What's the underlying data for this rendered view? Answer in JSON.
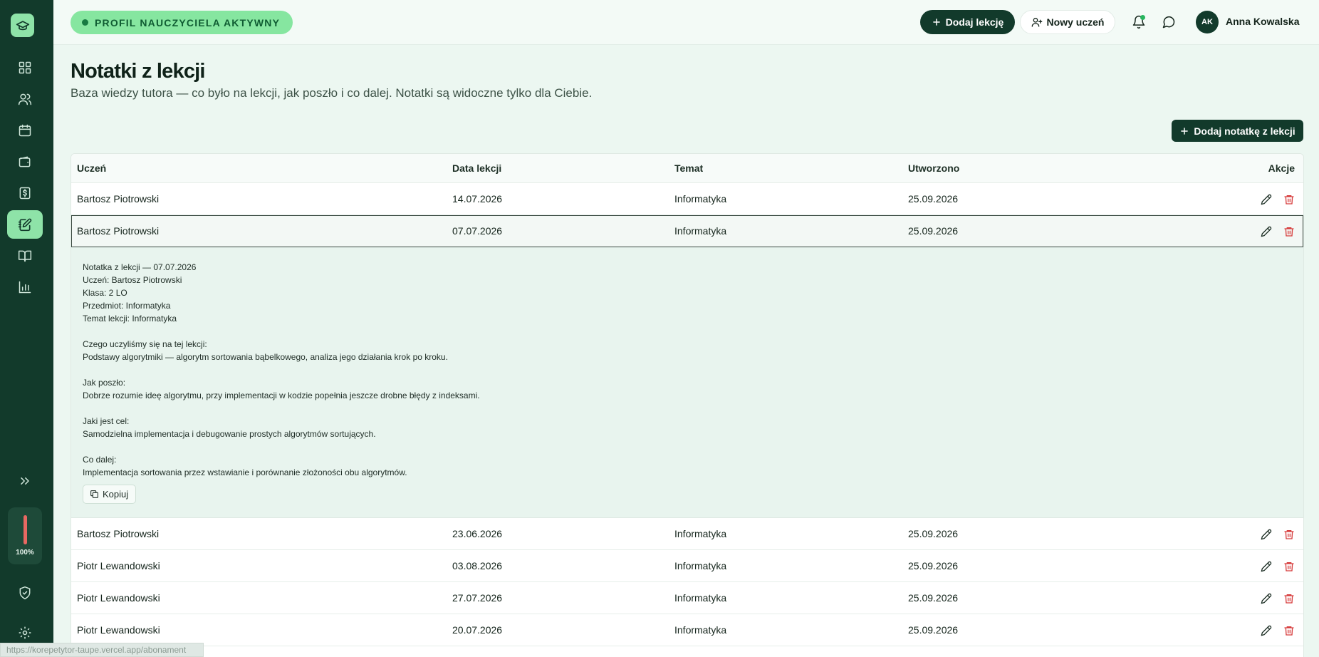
{
  "sidebar": {
    "logo_icon": "graduation-cap-icon",
    "items": [
      {
        "name": "dashboard",
        "icon": "grid-icon",
        "active": false
      },
      {
        "name": "students",
        "icon": "users-icon",
        "active": false
      },
      {
        "name": "calendar",
        "icon": "calendar-icon",
        "active": false
      },
      {
        "name": "wallet",
        "icon": "wallet-icon",
        "active": false
      },
      {
        "name": "payments",
        "icon": "dollar-icon",
        "active": false
      },
      {
        "name": "lesson-notes",
        "icon": "notebook-pen-icon",
        "active": true
      },
      {
        "name": "materials",
        "icon": "book-open-icon",
        "active": false
      },
      {
        "name": "reports",
        "icon": "bar-chart-icon",
        "active": false
      }
    ],
    "usage_label": "100%",
    "usage_level": 1.0
  },
  "topbar": {
    "status_badge": "PROFIL NAUCZYCIELA AKTYWNY",
    "add_lesson_label": "Dodaj lekcję",
    "new_student_label": "Nowy uczeń",
    "user_initials": "AK",
    "user_name": "Anna Kowalska"
  },
  "page": {
    "title": "Notatki z lekcji",
    "subtitle": "Baza wiedzy tutora — co było na lekcji, jak poszło i co dalej. Notatki są widoczne tylko dla Ciebie.",
    "add_note_label": "Dodaj notatkę z lekcji"
  },
  "table": {
    "columns": [
      "Uczeń",
      "Data lekcji",
      "Temat",
      "Utworzono",
      "Akcje"
    ],
    "rows": [
      {
        "student": "Bartosz Piotrowski",
        "date": "14.07.2026",
        "topic": "Informatyka",
        "created": "25.09.2026"
      },
      {
        "student": "Bartosz Piotrowski",
        "date": "07.07.2026",
        "topic": "Informatyka",
        "created": "25.09.2026"
      },
      {
        "student": "Bartosz Piotrowski",
        "date": "23.06.2026",
        "topic": "Informatyka",
        "created": "25.09.2026"
      },
      {
        "student": "Piotr Lewandowski",
        "date": "03.08.2026",
        "topic": "Informatyka",
        "created": "25.09.2026"
      },
      {
        "student": "Piotr Lewandowski",
        "date": "27.07.2026",
        "topic": "Informatyka",
        "created": "25.09.2026"
      },
      {
        "student": "Piotr Lewandowski",
        "date": "20.07.2026",
        "topic": "Informatyka",
        "created": "25.09.2026"
      }
    ],
    "detail": {
      "lines": [
        "Notatka z lekcji — 07.07.2026",
        "Uczeń: Bartosz Piotrowski",
        "Klasa: 2 LO",
        "Przedmiot: Informatyka",
        "Temat lekcji: Informatyka",
        "",
        "Czego uczyliśmy się na tej lekcji:",
        "Podstawy algorytmiki — algorytm sortowania bąbelkowego, analiza jego działania krok po kroku.",
        "",
        "Jak poszło:",
        "Dobrze rozumie ideę algorytmu, przy implementacji w kodzie popełnia jeszcze drobne błędy z indeksami.",
        "",
        "Jaki jest cel:",
        "Samodzielna implementacja i debugowanie prostych algorytmów sortujących.",
        "",
        "Co dalej:",
        "Implementacja sortowania przez wstawianie i porównanie złożoności obu algorytmów."
      ],
      "copy_label": "Kopiuj"
    }
  },
  "status_bar": {
    "url": "https://korepetytor-taupe.vercel.app/abonament"
  },
  "colors": {
    "sidebar_bg": "#123a2b",
    "accent_green": "#86e6a0",
    "delete_red": "#d63b3b",
    "page_bg": "#ecf7f1"
  }
}
